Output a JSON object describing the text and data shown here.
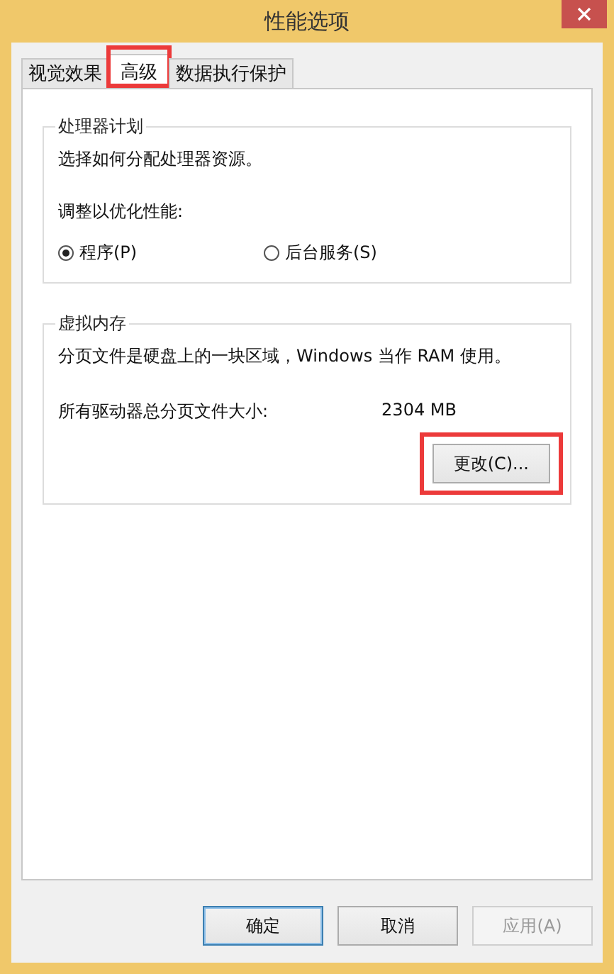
{
  "window": {
    "title": "性能选项"
  },
  "tabs": [
    {
      "label": "视觉效果",
      "selected": false,
      "highlighted": false
    },
    {
      "label": "高级",
      "selected": true,
      "highlighted": true
    },
    {
      "label": "数据执行保护",
      "selected": false,
      "highlighted": false
    }
  ],
  "processor_group": {
    "title": "处理器计划",
    "description": "选择如何分配处理器资源。",
    "prompt": "调整以优化性能:",
    "options": [
      {
        "label": "程序(P)",
        "selected": true
      },
      {
        "label": "后台服务(S)",
        "selected": false
      }
    ]
  },
  "memory_group": {
    "title": "虚拟内存",
    "description": "分页文件是硬盘上的一块区域，Windows 当作 RAM 使用。",
    "size_label": "所有驱动器总分页文件大小:",
    "size_value": "2304 MB",
    "change_button": {
      "label": "更改(C)...",
      "highlighted": true
    }
  },
  "buttons": [
    {
      "label": "确定",
      "default": true,
      "disabled": false
    },
    {
      "label": "取消",
      "default": false,
      "disabled": false
    },
    {
      "label": "应用(A)",
      "default": false,
      "disabled": true
    }
  ]
}
